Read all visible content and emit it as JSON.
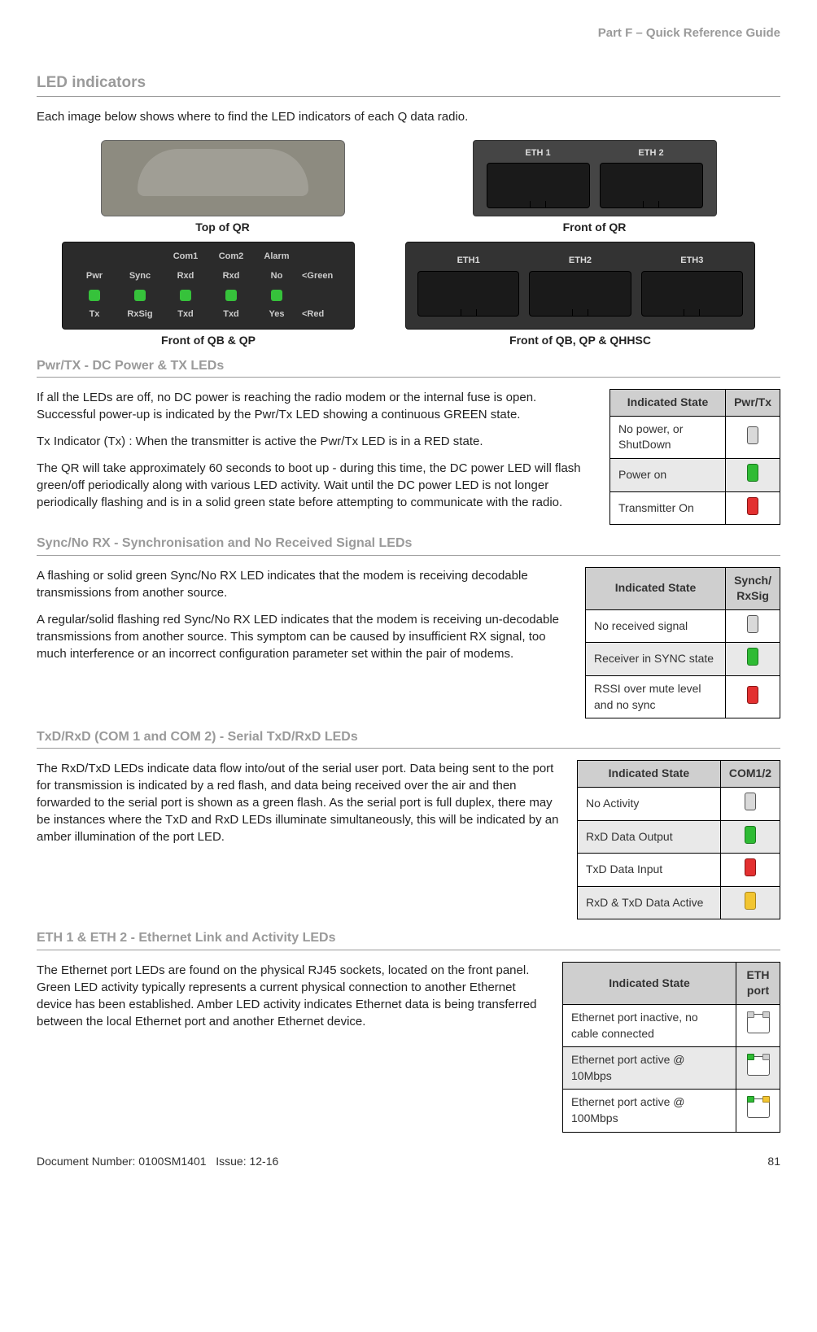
{
  "header": {
    "part": "Part F – Quick Reference Guide"
  },
  "section": {
    "title": "LED indicators"
  },
  "intro": "Each image below shows where to find the LED indicators of each Q data radio.",
  "images": {
    "top_qr_caption": "Top of QR",
    "front_qr_caption": "Front of QR",
    "front_qbqp_caption": "Front of QB & QP",
    "front_qbqp_hsc_caption": "Front of QB, QP & QHHSC",
    "eth1": "ETH 1",
    "eth2": "ETH 2",
    "e1": "ETH1",
    "e2": "ETH2",
    "e3": "ETH3",
    "panel": {
      "h1": "",
      "h2": "",
      "h3": "Com1",
      "h4": "Com2",
      "h5": "Alarm",
      "h6": "",
      "r1c1": "Pwr",
      "r1c2": "Sync",
      "r1c3": "Rxd",
      "r1c4": "Rxd",
      "r1c5": "No",
      "r1c6": "<Green",
      "r2c1": "Tx",
      "r2c2": "RxSig",
      "r2c3": "Txd",
      "r2c4": "Txd",
      "r2c5": "Yes",
      "r2c6": "<Red"
    }
  },
  "pwrtx": {
    "heading": "Pwr/TX - DC Power & TX LEDs",
    "p1": "If all the LEDs are off, no DC power is reaching the radio modem or the internal fuse is open. Successful power-up is indicated by the Pwr/Tx LED showing a continuous GREEN state.",
    "p2": "Tx Indicator (Tx) : When the transmitter is active the Pwr/Tx LED is in a RED state.",
    "p3": "The QR will take approximately 60 seconds to boot up - during this time, the DC power LED will flash green/off periodically along with various LED activity. Wait until the DC power LED is not longer periodically flashing and is in a solid green state before attempting to communicate with the radio.",
    "table": {
      "h1": "Indicated State",
      "h2": "Pwr/Tx",
      "r1": "No power, or ShutDown",
      "r2": "Power on",
      "r3": "Transmitter On"
    }
  },
  "sync": {
    "heading": "Sync/No RX - Synchronisation and No Received Signal LEDs",
    "p1": "A flashing or solid green Sync/No RX LED indicates that the modem is receiving decodable transmissions from another source.",
    "p2": "A regular/solid flashing red Sync/No RX LED indicates that the modem is receiving un-decodable transmissions from another source. This symptom can be caused by insufficient RX signal, too much interference or an incorrect configuration parameter set within the pair of modems.",
    "table": {
      "h1": "Indicated State",
      "h2": "Synch/ RxSig",
      "r1": "No received signal",
      "r2": "Receiver in SYNC state",
      "r3": "RSSI over mute level and no sync"
    }
  },
  "txd": {
    "heading": "TxD/RxD (COM 1 and COM 2) - Serial TxD/RxD LEDs",
    "p1": "The RxD/TxD LEDs  indicate data flow into/out of the serial user port. Data being sent to the port for transmission is indicated by a red flash, and data being received over the air and then forwarded to the serial port is shown as a green flash. As the serial port is full duplex, there may be instances where the TxD and RxD LEDs illuminate simultaneously, this will be indicated by an amber illumination of the port LED.",
    "table": {
      "h1": "Indicated State",
      "h2": "COM1/2",
      "r1": "No Activity",
      "r2": "RxD Data Output",
      "r3": "TxD Data Input",
      "r4": "RxD & TxD Data Active"
    }
  },
  "eth": {
    "heading": "ETH 1 & ETH 2 - Ethernet Link and Activity LEDs",
    "p1": "The Ethernet port LEDs are found on the physical RJ45 sockets, located on the front panel. Green LED activity typically represents a current physical connection to another Ethernet device has been established. Amber LED activity indicates Ethernet data is being transferred between the local Ethernet port and another Ethernet device.",
    "table": {
      "h1": "Indicated State",
      "h2": "ETH port",
      "r1": "Ethernet port inactive, no cable connected",
      "r2": "Ethernet port active @ 10Mbps",
      "r3": "Ethernet port active   @ 100Mbps"
    }
  },
  "footer": {
    "doc": "Document Number: 0100SM1401",
    "issue": "Issue: 12-16",
    "page": "81"
  }
}
